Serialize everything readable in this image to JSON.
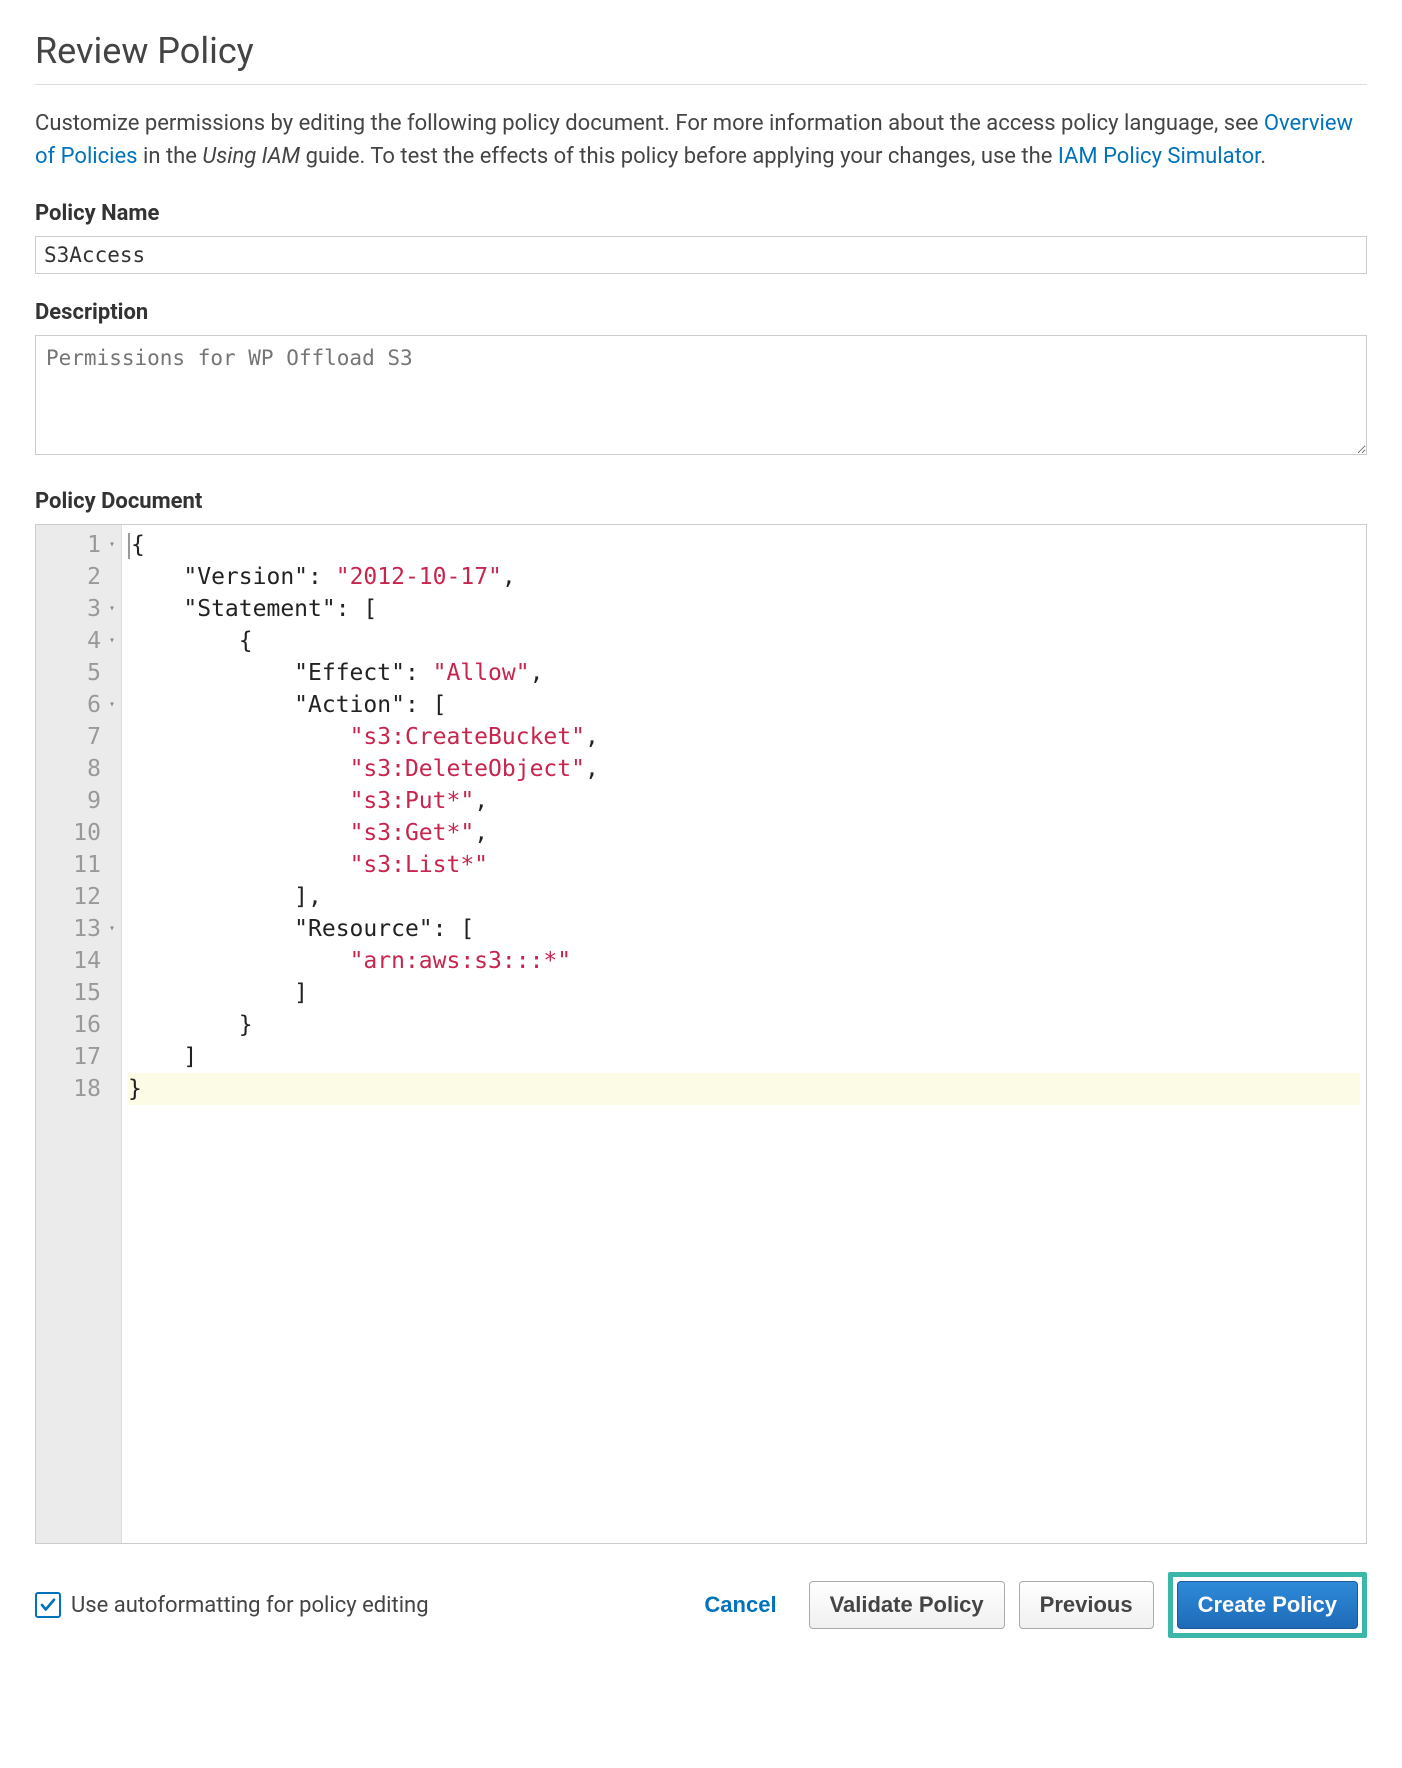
{
  "header": {
    "title": "Review Policy"
  },
  "intro": {
    "text_before": "Customize permissions by editing the following policy document. For more information about the access policy language, see ",
    "link1": "Overview of Policies",
    "text_mid1": " in the ",
    "italic": "Using IAM",
    "text_mid2": " guide. To test the effects of this policy before applying your changes, use the ",
    "link2": "IAM Policy Simulator",
    "text_after": "."
  },
  "fields": {
    "policy_name_label": "Policy Name",
    "policy_name_value": "S3Access",
    "description_label": "Description",
    "description_placeholder": "Permissions for WP Offload S3",
    "policy_document_label": "Policy Document"
  },
  "editor": {
    "lines": [
      {
        "n": 1,
        "fold": true,
        "tokens": [
          {
            "t": "pun",
            "v": "{"
          }
        ]
      },
      {
        "n": 2,
        "fold": false,
        "tokens": [
          {
            "t": "ind",
            "v": "    "
          },
          {
            "t": "key",
            "v": "\"Version\""
          },
          {
            "t": "pun",
            "v": ": "
          },
          {
            "t": "str",
            "v": "\"2012-10-17\""
          },
          {
            "t": "pun",
            "v": ","
          }
        ]
      },
      {
        "n": 3,
        "fold": true,
        "tokens": [
          {
            "t": "ind",
            "v": "    "
          },
          {
            "t": "key",
            "v": "\"Statement\""
          },
          {
            "t": "pun",
            "v": ": ["
          }
        ]
      },
      {
        "n": 4,
        "fold": true,
        "tokens": [
          {
            "t": "ind",
            "v": "        "
          },
          {
            "t": "pun",
            "v": "{"
          }
        ]
      },
      {
        "n": 5,
        "fold": false,
        "tokens": [
          {
            "t": "ind",
            "v": "            "
          },
          {
            "t": "key",
            "v": "\"Effect\""
          },
          {
            "t": "pun",
            "v": ": "
          },
          {
            "t": "str",
            "v": "\"Allow\""
          },
          {
            "t": "pun",
            "v": ","
          }
        ]
      },
      {
        "n": 6,
        "fold": true,
        "tokens": [
          {
            "t": "ind",
            "v": "            "
          },
          {
            "t": "key",
            "v": "\"Action\""
          },
          {
            "t": "pun",
            "v": ": ["
          }
        ]
      },
      {
        "n": 7,
        "fold": false,
        "tokens": [
          {
            "t": "ind",
            "v": "                "
          },
          {
            "t": "str",
            "v": "\"s3:CreateBucket\""
          },
          {
            "t": "pun",
            "v": ","
          }
        ]
      },
      {
        "n": 8,
        "fold": false,
        "tokens": [
          {
            "t": "ind",
            "v": "                "
          },
          {
            "t": "str",
            "v": "\"s3:DeleteObject\""
          },
          {
            "t": "pun",
            "v": ","
          }
        ]
      },
      {
        "n": 9,
        "fold": false,
        "tokens": [
          {
            "t": "ind",
            "v": "                "
          },
          {
            "t": "str",
            "v": "\"s3:Put*\""
          },
          {
            "t": "pun",
            "v": ","
          }
        ]
      },
      {
        "n": 10,
        "fold": false,
        "tokens": [
          {
            "t": "ind",
            "v": "                "
          },
          {
            "t": "str",
            "v": "\"s3:Get*\""
          },
          {
            "t": "pun",
            "v": ","
          }
        ]
      },
      {
        "n": 11,
        "fold": false,
        "tokens": [
          {
            "t": "ind",
            "v": "                "
          },
          {
            "t": "str",
            "v": "\"s3:List*\""
          }
        ]
      },
      {
        "n": 12,
        "fold": false,
        "tokens": [
          {
            "t": "ind",
            "v": "            "
          },
          {
            "t": "pun",
            "v": "],"
          }
        ]
      },
      {
        "n": 13,
        "fold": true,
        "tokens": [
          {
            "t": "ind",
            "v": "            "
          },
          {
            "t": "key",
            "v": "\"Resource\""
          },
          {
            "t": "pun",
            "v": ": ["
          }
        ]
      },
      {
        "n": 14,
        "fold": false,
        "tokens": [
          {
            "t": "ind",
            "v": "                "
          },
          {
            "t": "str",
            "v": "\"arn:aws:s3:::*\""
          }
        ]
      },
      {
        "n": 15,
        "fold": false,
        "tokens": [
          {
            "t": "ind",
            "v": "            "
          },
          {
            "t": "pun",
            "v": "]"
          }
        ]
      },
      {
        "n": 16,
        "fold": false,
        "tokens": [
          {
            "t": "ind",
            "v": "        "
          },
          {
            "t": "pun",
            "v": "}"
          }
        ]
      },
      {
        "n": 17,
        "fold": false,
        "tokens": [
          {
            "t": "ind",
            "v": "    "
          },
          {
            "t": "pun",
            "v": "]"
          }
        ]
      },
      {
        "n": 18,
        "fold": false,
        "hl": true,
        "tokens": [
          {
            "t": "pun",
            "v": "}"
          }
        ]
      }
    ]
  },
  "footer": {
    "autoformat_label": "Use autoformatting for policy editing",
    "autoformat_checked": true,
    "cancel": "Cancel",
    "validate": "Validate Policy",
    "previous": "Previous",
    "create": "Create Policy"
  }
}
